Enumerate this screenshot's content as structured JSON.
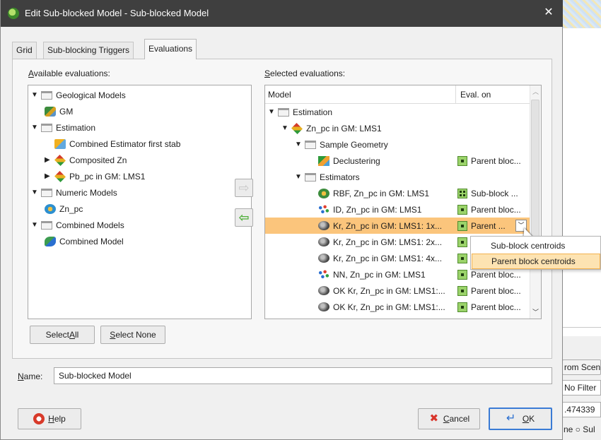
{
  "dialog": {
    "title": "Edit Sub-blocked Model - Sub-blocked Model",
    "close_glyph": "✕",
    "tabs": [
      "Grid",
      "Sub-blocking Triggers",
      "Evaluations"
    ],
    "available_label_prefix": "A",
    "available_label_rest": "vailable evaluations:",
    "selected_label_prefix": "S",
    "selected_label_rest": "elected evaluations:",
    "available_tree": [
      {
        "label": "Geological Models",
        "icon": "folder-icon",
        "arrow": "▼"
      },
      {
        "label": "GM",
        "icon": "model-icon",
        "arrow": ""
      },
      {
        "label": "Estimation",
        "icon": "folder-icon",
        "arrow": "▼"
      },
      {
        "label": "Combined Estimator first stab",
        "icon": "estimator-icon",
        "arrow": ""
      },
      {
        "label": "Composited Zn",
        "icon": "diamond-icon",
        "arrow": "▶"
      },
      {
        "label": "Pb_pc in GM: LMS1",
        "icon": "diamond-icon",
        "arrow": "▶"
      },
      {
        "label": "Numeric Models",
        "icon": "folder-icon",
        "arrow": "▼"
      },
      {
        "label": "Zn_pc",
        "icon": "zn-icon",
        "arrow": ""
      },
      {
        "label": "Combined Models",
        "icon": "folder-icon",
        "arrow": "▼"
      },
      {
        "label": "Combined Model",
        "icon": "combined-icon",
        "arrow": ""
      }
    ],
    "selected_table": {
      "col_model": "Model",
      "col_eval": "Eval. on",
      "rows": [
        {
          "label": "Estimation",
          "icon": "folder-icon",
          "arrow": "▼",
          "eval": ""
        },
        {
          "label": "Zn_pc in GM: LMS1",
          "icon": "diamond-icon",
          "arrow": "▼",
          "eval": ""
        },
        {
          "label": "Sample Geometry",
          "icon": "folder-icon",
          "arrow": "▼",
          "eval": ""
        },
        {
          "label": "Declustering",
          "icon": "decl-icon",
          "arrow": "",
          "eval": "Parent bloc..."
        },
        {
          "label": "Estimators",
          "icon": "folder-icon",
          "arrow": "▼",
          "eval": ""
        },
        {
          "label": "RBF, Zn_pc in GM: LMS1",
          "icon": "rbf-icon",
          "arrow": "",
          "eval": "Sub-block ..."
        },
        {
          "label": "ID, Zn_pc in GM: LMS1",
          "icon": "dots-icon",
          "arrow": "",
          "eval": "Parent bloc..."
        },
        {
          "label": "Kr, Zn_pc in GM: LMS1: 1x...",
          "icon": "kr-icon",
          "arrow": "",
          "eval": "Parent ..."
        },
        {
          "label": "Kr, Zn_pc in GM: LMS1: 2x...",
          "icon": "kr-icon",
          "arrow": "",
          "eval": ""
        },
        {
          "label": "Kr, Zn_pc in GM: LMS1: 4x...",
          "icon": "kr-icon",
          "arrow": "",
          "eval": ""
        },
        {
          "label": "NN, Zn_pc in GM: LMS1",
          "icon": "dots-icon",
          "arrow": "",
          "eval": "Parent bloc..."
        },
        {
          "label": "OK Kr, Zn_pc in GM: LMS1:...",
          "icon": "kr-icon",
          "arrow": "",
          "eval": "Parent bloc..."
        },
        {
          "label": "OK Kr, Zn_pc in GM: LMS1:...",
          "icon": "kr-icon",
          "arrow": "",
          "eval": "Parent bloc..."
        }
      ]
    },
    "dropdown_options": [
      "Sub-block centroids",
      "Parent block centroids"
    ],
    "select_all_prefix": "Select ",
    "select_all_key": "A",
    "select_all_rest": "ll",
    "select_none_key": "S",
    "select_none_rest": "elect None",
    "name_label_key": "N",
    "name_label_rest": "ame:",
    "name_value": "Sub-blocked Model",
    "help_key": "H",
    "help_rest": "elp",
    "cancel_key": "C",
    "cancel_rest": "ancel",
    "ok_key": "O",
    "ok_rest": "K",
    "add_arrow": "⇨",
    "remove_arrow": "⇦"
  },
  "background": {
    "from_scene": "rom Scen",
    "no_filter": "No Filter",
    "value": ".474339",
    "radio_text": "ne ○ Sul"
  },
  "colors": {
    "selection": "#fbc57c",
    "titlebar": "#3f3f3f",
    "accent_green": "#4fae3a"
  }
}
